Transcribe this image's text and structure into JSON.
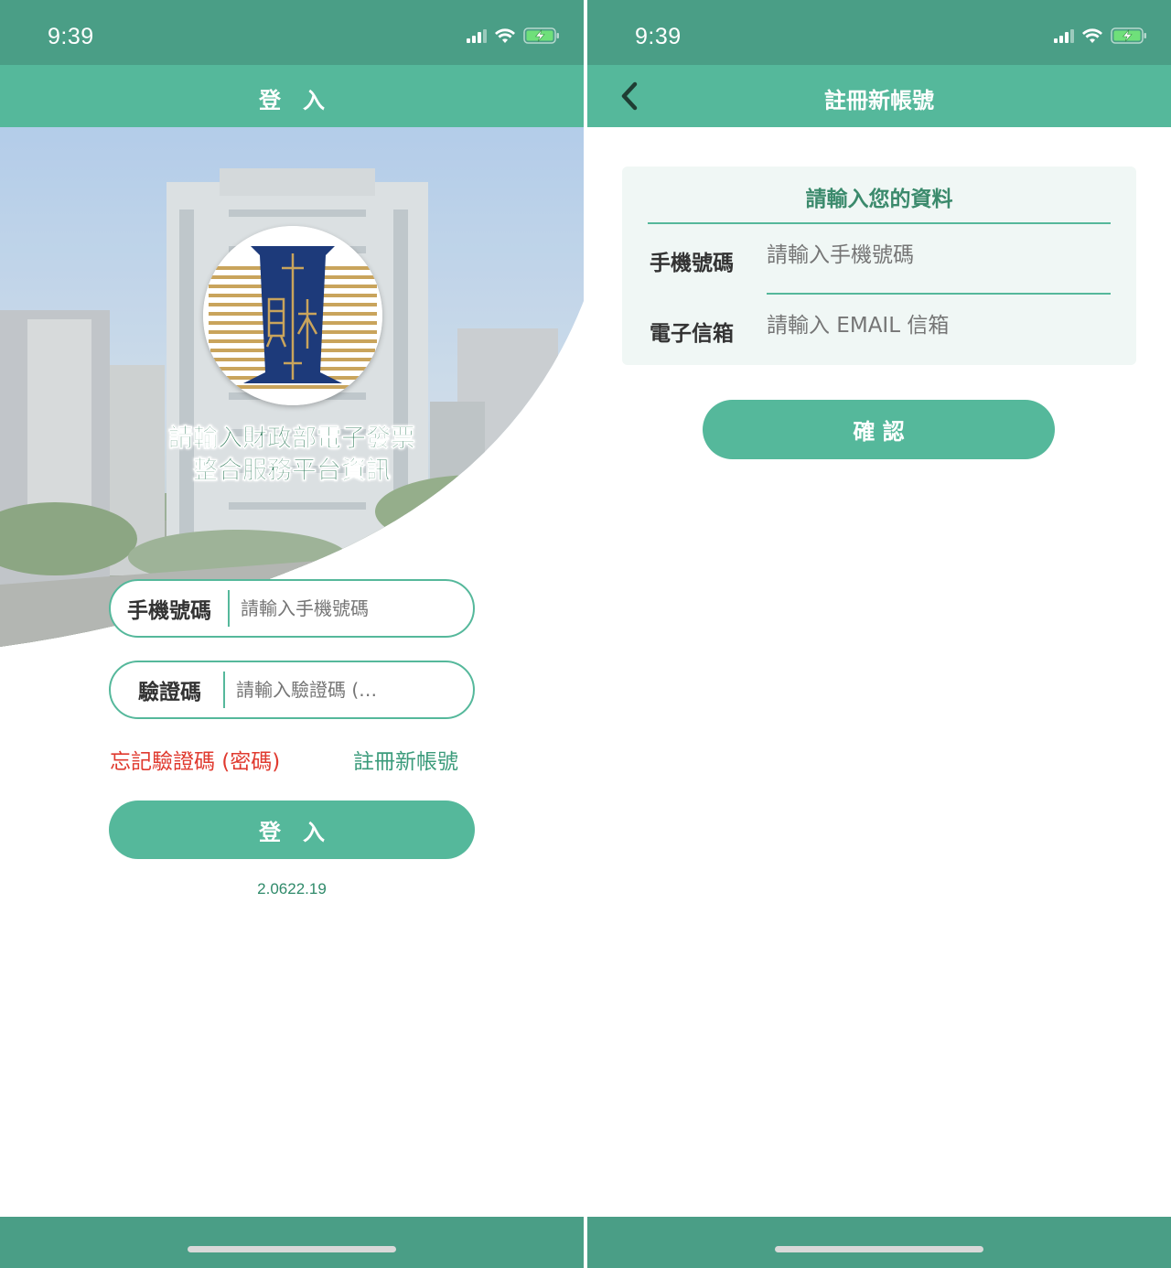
{
  "login_screen": {
    "status": {
      "time": "9:39"
    },
    "nav": {
      "title": "登　入"
    },
    "hero": {
      "title_line1": "請輸入財政部電子發票",
      "title_line2": "整合服務平台資訊"
    },
    "phone_input": {
      "label": "手機號碼",
      "placeholder": "請輸入手機號碼"
    },
    "code_input": {
      "label": "驗證碼",
      "placeholder": "請輸入驗證碼 (…"
    },
    "forgot_link": "忘記驗證碼 (密碼)",
    "register_link": "註冊新帳號",
    "login_button": "登入",
    "version": "2.0622.19"
  },
  "register_screen": {
    "status": {
      "time": "9:39"
    },
    "nav": {
      "title": "註冊新帳號"
    },
    "form": {
      "heading": "請輸入您的資料",
      "phone_label": "手機號碼",
      "phone_placeholder": "請輸入手機號碼",
      "email_label": "電子信箱",
      "email_placeholder": "請輸入 EMAIL 信箱"
    },
    "confirm_button": "確 認"
  },
  "colors": {
    "status_bar": "#4a9e86",
    "nav_bar": "#55b89b",
    "accent_text": "#3b9b7b",
    "warning_text": "#e03a2f",
    "logo_navy": "#1d3a7a",
    "logo_gold": "#c9a45c"
  },
  "icons": [
    "signal-icon",
    "wifi-icon",
    "battery-charging-icon",
    "back-chevron-icon",
    "ministry-of-finance-logo"
  ]
}
